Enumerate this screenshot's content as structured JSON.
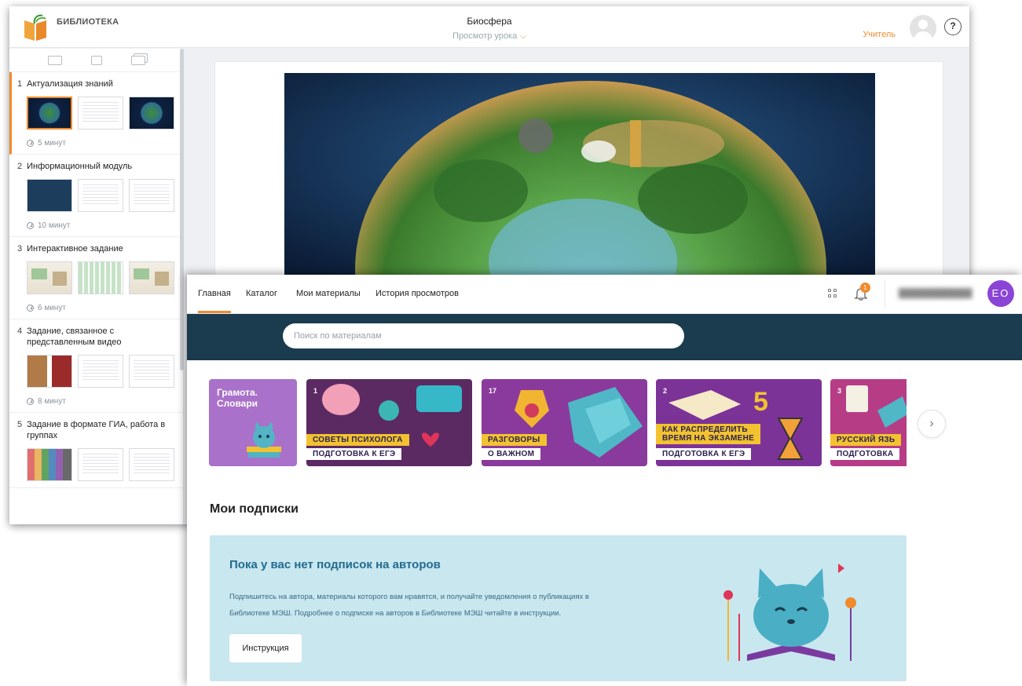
{
  "lesson_viewer": {
    "logo_text": "БИБЛИОТЕКА",
    "title": "Биосфера",
    "view_label": "Просмотр урока",
    "role": "Учитель",
    "help_icon": "?",
    "blocks": [
      {
        "num": "1",
        "title": "Актуализация знаний",
        "duration": "5 минут"
      },
      {
        "num": "2",
        "title": "Информационный модуль",
        "duration": "10 минут"
      },
      {
        "num": "3",
        "title": "Интерактивное задание",
        "duration": "6 минут"
      },
      {
        "num": "4",
        "title": "Задание, связанное с представленным видео",
        "duration": "8 минут"
      },
      {
        "num": "5",
        "title": "Задание в формате ГИА, работа в группах",
        "duration": ""
      }
    ]
  },
  "library": {
    "nav": {
      "home": "Главная",
      "catalog": "Каталог",
      "my_materials": "Мои материалы",
      "history": "История просмотров"
    },
    "notifications_count": "1",
    "user_initials": "ЕО",
    "search": {
      "placeholder": "Поиск по материалам"
    },
    "cards": {
      "c0": {
        "title": "Грамота. Словари"
      },
      "c1": {
        "number": "1",
        "top": "СОВЕТЫ ПСИХОЛОГА",
        "bottom": "ПОДГОТОВКА К ЕГЭ"
      },
      "c2": {
        "number": "17",
        "top": "РАЗГОВОРЫ",
        "bottom": "О ВАЖНОМ"
      },
      "c3": {
        "number": "2",
        "top1": "КАК РАСПРЕДЕЛИТЬ",
        "top2": "ВРЕМЯ НА ЭКЗАМЕНЕ",
        "bottom": "ПОДГОТОВКА К ЕГЭ"
      },
      "c4": {
        "number": "3",
        "top": "РУССКИЙ ЯЗЬ",
        "bottom": "ПОДГОТОВКА"
      }
    },
    "subscriptions": {
      "section_title": "Мои подписки",
      "empty_title": "Пока у вас нет подписок на авторов",
      "empty_text_line1": "Подпишитесь на автора, материалы которого вам нравятся, и получайте уведомления о публикациях в",
      "empty_text_line2": "Библиотеке МЭШ. Подробнее о подписке на авторов в Библиотеке МЭШ читайте в инструкции.",
      "instruction_button": "Инструкция"
    }
  },
  "colors": {
    "accent": "#f08a2c",
    "header_band": "#1b3b4e",
    "avatar": "#8b45d6",
    "subs_panel": "#c8e7ef",
    "subs_title": "#236b90"
  },
  "icons": [
    "book-logo-icon",
    "monitor-icon",
    "tablet-icon",
    "stack-icon",
    "clock-icon",
    "grid-icon",
    "bell-icon",
    "chevron-down-icon",
    "chevron-right-icon",
    "help-icon"
  ]
}
